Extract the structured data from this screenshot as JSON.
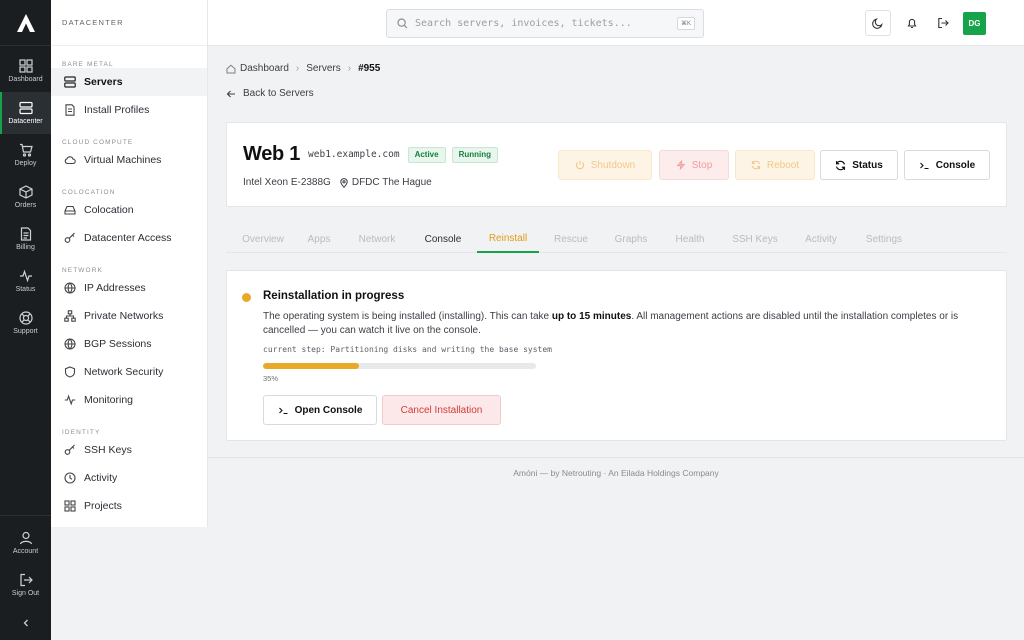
{
  "rail": {
    "items": [
      {
        "label": "Dashboard",
        "icon": "grid-icon"
      },
      {
        "label": "Datacenter",
        "icon": "server-icon",
        "active": true
      },
      {
        "label": "Deploy",
        "icon": "cart-icon"
      },
      {
        "label": "Orders",
        "icon": "box-icon"
      },
      {
        "label": "Billing",
        "icon": "document-icon"
      },
      {
        "label": "Status",
        "icon": "pulse-icon"
      },
      {
        "label": "Support",
        "icon": "lifebuoy-icon"
      }
    ],
    "bottom": [
      {
        "label": "Account",
        "icon": "user-icon"
      },
      {
        "label": "Sign Out",
        "icon": "sign-out-icon"
      }
    ]
  },
  "sidebar": {
    "title": "DATACENTER",
    "sections": [
      {
        "label": "BARE METAL",
        "items": [
          {
            "label": "Servers",
            "active": true
          },
          {
            "label": "Install Profiles"
          }
        ]
      },
      {
        "label": "CLOUD COMPUTE",
        "items": [
          {
            "label": "Virtual Machines"
          }
        ]
      },
      {
        "label": "COLOCATION",
        "items": [
          {
            "label": "Colocation"
          },
          {
            "label": "Datacenter Access"
          }
        ]
      },
      {
        "label": "NETWORK",
        "items": [
          {
            "label": "IP Addresses"
          },
          {
            "label": "Private Networks"
          },
          {
            "label": "BGP Sessions"
          },
          {
            "label": "Network Security"
          },
          {
            "label": "Monitoring"
          }
        ]
      },
      {
        "label": "IDENTITY",
        "items": [
          {
            "label": "SSH Keys"
          },
          {
            "label": "Activity"
          },
          {
            "label": "Projects"
          }
        ]
      }
    ]
  },
  "topbar": {
    "search_placeholder": "Search servers, invoices, tickets...",
    "search_shortcut": "⌘K",
    "avatar_initials": "DG"
  },
  "breadcrumb": {
    "home": "Dashboard",
    "section": "Servers",
    "current": "#955"
  },
  "back_label": "Back to Servers",
  "server": {
    "name": "Web 1",
    "hostname": "web1.example.com",
    "badges": [
      "Active",
      "Running"
    ],
    "cpu": "Intel Xeon E-2388G",
    "location": "DFDC The Hague"
  },
  "actions": {
    "shutdown": "Shutdown",
    "stop": "Stop",
    "reboot": "Reboot",
    "status": "Status",
    "console": "Console"
  },
  "tabs": [
    "Overview",
    "Apps",
    "Network",
    "Console",
    "Reinstall",
    "Rescue",
    "Graphs",
    "Health",
    "SSH Keys",
    "Activity",
    "Settings"
  ],
  "active_tab": "Reinstall",
  "progress": {
    "title": "Reinstallation in progress",
    "desc_before": "The operating system is being installed (installing). This can take ",
    "desc_bold": "up to 15 minutes",
    "desc_after": ". All management actions are disabled until the installation completes or is cancelled — you can watch it live on the console.",
    "step": "current step: Partitioning disks and writing the base system",
    "percent": 35,
    "percent_label": "35%",
    "open_console": "Open Console",
    "cancel": "Cancel Installation"
  },
  "footer": "Amóni — by Netrouting · An Eilada Holdings Company",
  "colors": {
    "accent": "#16a34a",
    "warning": "#e9a825",
    "danger": "#d43c3c",
    "rail_bg": "#1b1e21"
  }
}
